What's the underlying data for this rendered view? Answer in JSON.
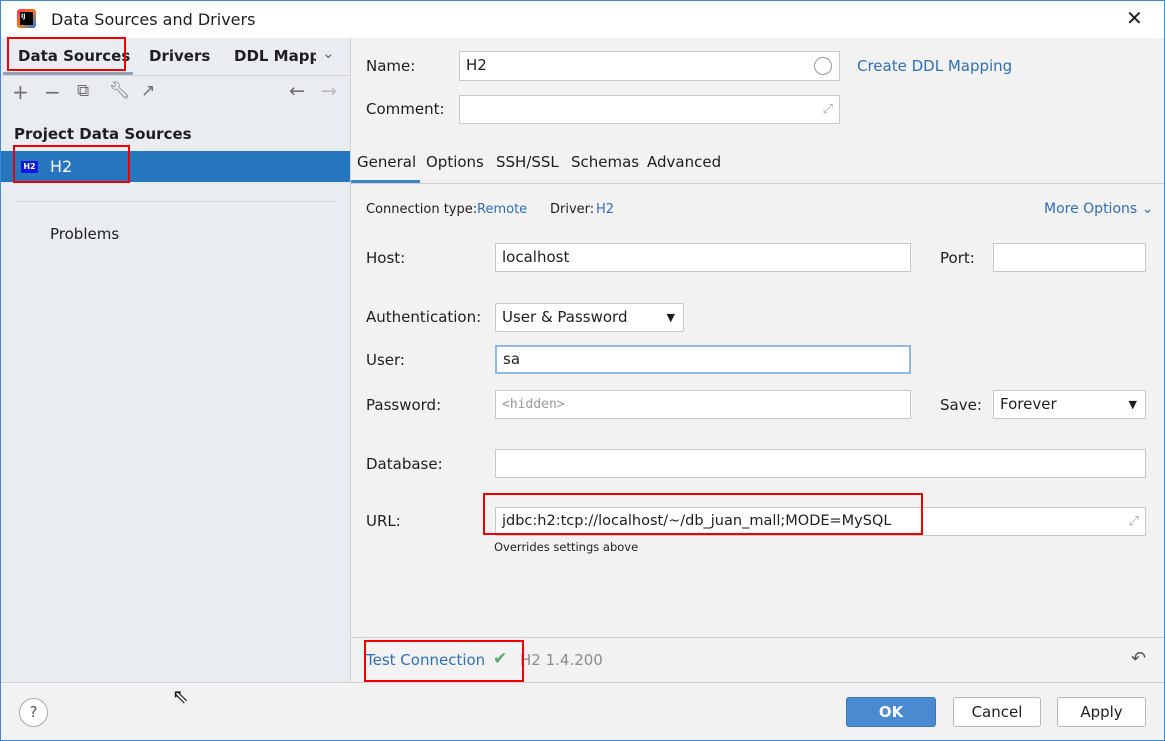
{
  "window": {
    "title": "Data Sources and Drivers"
  },
  "left": {
    "tabs": [
      "Data Sources",
      "Drivers",
      "DDL Mappi"
    ],
    "section": "Project Data Sources",
    "items": [
      {
        "label": "H2",
        "icon_text": "H2"
      }
    ],
    "problems": "Problems"
  },
  "form": {
    "name_label": "Name:",
    "name_value": "H2",
    "create_ddl": "Create DDL Mapping",
    "comment_label": "Comment:",
    "comment_value": "",
    "tabs": [
      "General",
      "Options",
      "SSH/SSL",
      "Schemas",
      "Advanced"
    ],
    "conn_type_label": "Connection type:",
    "conn_type": "Remote",
    "driver_label": "Driver:",
    "driver": "H2",
    "more_options": "More Options",
    "host_label": "Host:",
    "host": "localhost",
    "port_label": "Port:",
    "port": "",
    "auth_label": "Authentication:",
    "auth": "User & Password",
    "user_label": "User:",
    "user": "sa",
    "password_label": "Password:",
    "password_placeholder": "<hidden>",
    "save_label": "Save:",
    "save": "Forever",
    "database_label": "Database:",
    "database": "",
    "url_label": "URL:",
    "url": "jdbc:h2:tcp://localhost/~/db_juan_mall;MODE=MySQL",
    "url_hint": "Overrides settings above"
  },
  "footer": {
    "test_connection": "Test Connection",
    "version": "H2 1.4.200",
    "ok": "OK",
    "cancel": "Cancel",
    "apply": "Apply",
    "help": "?"
  },
  "colors": {
    "accent": "#2675bf",
    "link": "#2f6fb5",
    "annotation": "#ee0000",
    "success": "#59a869"
  }
}
